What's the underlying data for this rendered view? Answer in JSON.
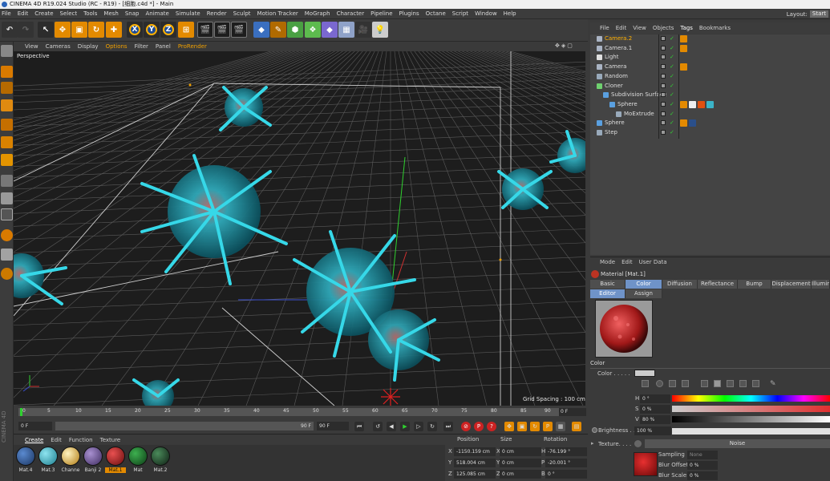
{
  "titlebar": {
    "title": "CINEMA 4D R19.024 Studio (RC - R19) - [细胞.c4d *] - Main"
  },
  "menu": {
    "items": [
      "File",
      "Edit",
      "Create",
      "Select",
      "Tools",
      "Mesh",
      "Snap",
      "Animate",
      "Simulate",
      "Render",
      "Sculpt",
      "Motion Tracker",
      "MoGraph",
      "Character",
      "Pipeline",
      "Plugins",
      "Octane",
      "Script",
      "Window",
      "Help"
    ],
    "layout_label": "Layout:",
    "layout_value": "Start"
  },
  "toolbar": {
    "axis_x": "X",
    "axis_y": "Y",
    "axis_z": "Z"
  },
  "viewport": {
    "menu": [
      "View",
      "Cameras",
      "Display",
      "Options",
      "Filter",
      "Panel",
      "ProRender"
    ],
    "label": "Perspective",
    "grid_spacing": "Grid Spacing : 100 cm"
  },
  "timeline": {
    "ticks": [
      "0",
      "5",
      "10",
      "15",
      "20",
      "25",
      "30",
      "35",
      "40",
      "45",
      "50",
      "55",
      "60",
      "65",
      "70",
      "75",
      "80",
      "85",
      "90"
    ],
    "current_frame": "0 F",
    "start_field": "0 F",
    "slider_end": "90 F",
    "end_field": "90 F",
    "playhead_fraction": 0
  },
  "material_manager": {
    "tabs": [
      "Create",
      "Edit",
      "Function",
      "Texture"
    ],
    "materials": [
      {
        "name": "Mat.4",
        "color": "#2a4f8a"
      },
      {
        "name": "Mat.3",
        "color": "#3bb4c8"
      },
      {
        "name": "Channe",
        "color": "#d9a030"
      },
      {
        "name": "Banji 2",
        "color": "#6a4a8a"
      },
      {
        "name": "Mat.1",
        "color": "#b3201e"
      },
      {
        "name": "Mat",
        "color": "#1f6e2b"
      },
      {
        "name": "Mat.2",
        "color": "#3a3a3a"
      }
    ],
    "selected": "Mat.1"
  },
  "coordinates": {
    "headers": [
      "Position",
      "Size",
      "Rotation"
    ],
    "rows": [
      {
        "axis": "X",
        "pos": "-1150.159 cm",
        "size": "0 cm",
        "rot_label": "H",
        "rot": "-76.199 °"
      },
      {
        "axis": "Y",
        "pos": "518.004 cm",
        "size": "0 cm",
        "rot_label": "P",
        "rot": "-20.001 °"
      },
      {
        "axis": "Z",
        "pos": "125.085 cm",
        "size": "0 cm",
        "rot_label": "B",
        "rot": "0 °"
      }
    ]
  },
  "object_manager": {
    "menu": [
      "File",
      "Edit",
      "View",
      "Objects",
      "Tags",
      "Bookmarks"
    ],
    "objects": [
      {
        "name": "Camera.2",
        "indent": 0,
        "selected": true,
        "color": "#aab4c4"
      },
      {
        "name": "Camera.1",
        "indent": 0,
        "selected": false,
        "color": "#aab4c4"
      },
      {
        "name": "Light",
        "indent": 0,
        "selected": false,
        "color": "#e0e0e0"
      },
      {
        "name": "Camera",
        "indent": 0,
        "selected": false,
        "color": "#aab4c4"
      },
      {
        "name": "Random",
        "indent": 0,
        "selected": false,
        "color": "#9ab"
      },
      {
        "name": "Cloner",
        "indent": 0,
        "selected": false,
        "color": "#6fd06f"
      },
      {
        "name": "Subdivision Surface",
        "indent": 1,
        "selected": false,
        "color": "#5aa0e0"
      },
      {
        "name": "Sphere",
        "indent": 2,
        "selected": false,
        "color": "#5aa0e0"
      },
      {
        "name": "MoExtrude",
        "indent": 3,
        "selected": false,
        "color": "#9ab"
      },
      {
        "name": "Sphere",
        "indent": 0,
        "selected": false,
        "color": "#5aa0e0"
      },
      {
        "name": "Step",
        "indent": 0,
        "selected": false,
        "color": "#9ab"
      }
    ]
  },
  "attributes": {
    "menu": [
      "Mode",
      "Edit",
      "User Data"
    ],
    "material_name": "Material [Mat.1]",
    "tabs_row1": [
      "Basic",
      "Color",
      "Diffusion",
      "Reflectance",
      "Bump",
      "Displacement",
      "Illumin"
    ],
    "tabs_row2": [
      "Editor",
      "Assign"
    ],
    "active_tab": "Color",
    "section": "Color",
    "color_label": "Color . . . . .",
    "h_label": "H",
    "h_value": "0 °",
    "s_label": "S",
    "s_value": "0 %",
    "v_label": "V",
    "v_value": "80 %",
    "brightness_label": "Brightness . .",
    "brightness_value": "100 %",
    "texture_label": "Texture. . . .",
    "texture_value": "Noise",
    "sampling_label": "Sampling",
    "sampling_value": "None",
    "blur_offset_label": "Blur Offset",
    "blur_offset_value": "0 %",
    "blur_scale_label": "Blur Scale",
    "blur_scale_value": "0 %"
  },
  "sidebar_vertical_text": "CINEMA 4D"
}
